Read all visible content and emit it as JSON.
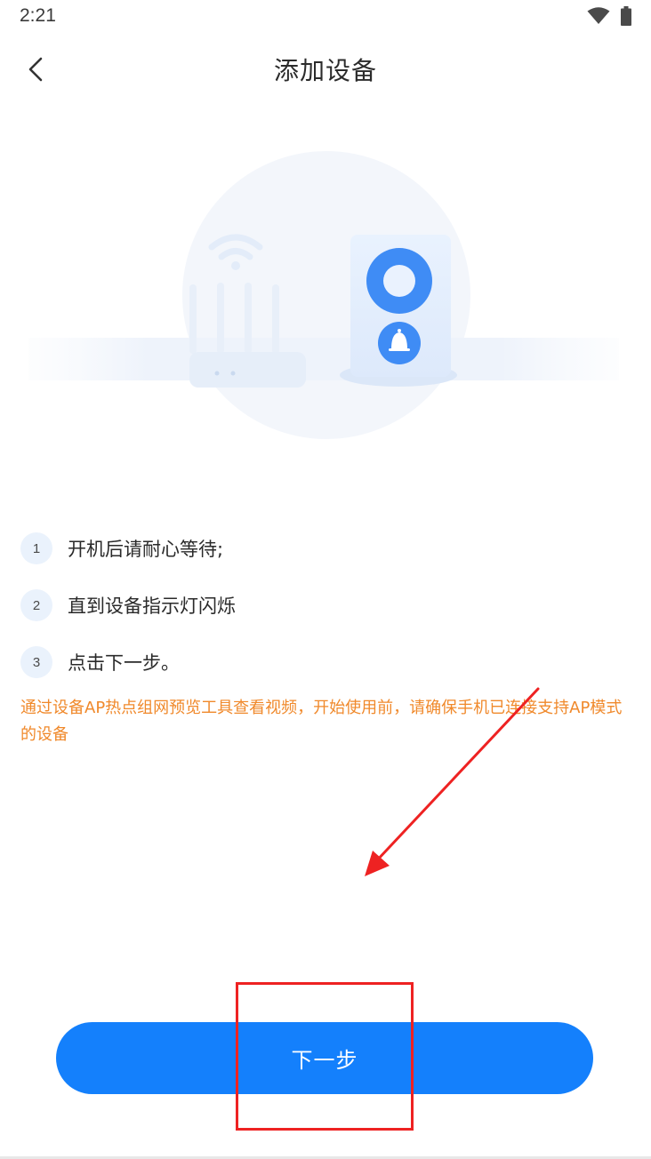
{
  "status_bar": {
    "time": "2:21",
    "icons": [
      "wifi-icon",
      "battery-icon"
    ]
  },
  "header": {
    "back_icon": "chevron-left-icon",
    "title": "添加设备"
  },
  "illustration": {
    "description_icons": [
      "wifi-signal-icon",
      "router-icon",
      "camera-doorbell-icon",
      "bell-icon"
    ],
    "colors": {
      "circle_bg": "#f2f6fc",
      "device_body": "#e6f0fd",
      "lens_ring": "#3f8cf5",
      "router": "#e8f0fb"
    }
  },
  "steps": [
    {
      "number": "1",
      "text": "开机后请耐心等待;"
    },
    {
      "number": "2",
      "text": "直到设备指示灯闪烁"
    },
    {
      "number": "3",
      "text": "点击下一步。"
    }
  ],
  "notice": {
    "text": "通过设备AP热点组网预览工具查看视频，开始使用前，请确保手机已连接支持AP模式的设备",
    "color": "#f0892b"
  },
  "next_button": {
    "label": "下一步",
    "color": "#1480fc"
  },
  "annotations": {
    "arrow_color": "#ee2222",
    "box_color": "#ee2222"
  }
}
